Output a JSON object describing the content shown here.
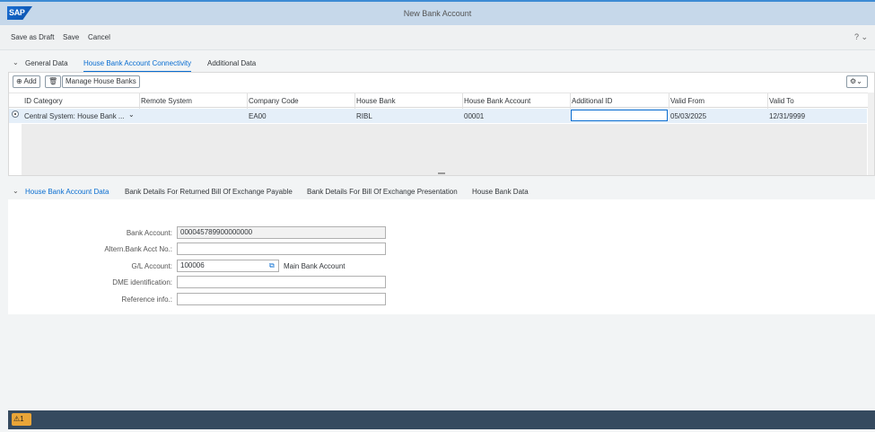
{
  "window": {
    "logo": "SAP",
    "title": "New Bank Account"
  },
  "toolbar": {
    "save_draft": "Save as Draft",
    "save": "Save",
    "cancel": "Cancel",
    "help_icon": "help-icon"
  },
  "top_tabs": [
    "General Data",
    "House Bank Account Connectivity",
    "Additional Data"
  ],
  "grid": {
    "add_label": "Add",
    "manage_label": "Manage House Banks",
    "columns": [
      "ID Category",
      "Remote System",
      "Company Code",
      "House Bank",
      "House Bank Account",
      "Additional ID",
      "Valid From",
      "Valid To"
    ],
    "rows": [
      [
        "Central System: House Bank ...",
        "",
        "EA00",
        "RIBL",
        "00001",
        "",
        "05/03/2025",
        "12/31/9999"
      ]
    ]
  },
  "bottom_tabs": [
    "House Bank Account Data",
    "Bank Details For Returned Bill Of Exchange Payable",
    "Bank Details For Bill Of Exchange Presentation",
    "House Bank Data"
  ],
  "form": {
    "bank_account_label": "Bank Account:",
    "bank_account_value": "000045789900000000",
    "altern_label": "Altern.Bank Acct No.:",
    "altern_value": "",
    "gl_label": "G/L Account:",
    "gl_value": "100006",
    "gl_desc": "Main Bank Account",
    "dme_label": "DME identification:",
    "dme_value": "",
    "ref_label": "Reference info.:",
    "ref_value": ""
  },
  "status": {
    "warning_count": "1"
  },
  "colors": {
    "accent": "#0a6ed1",
    "titlebar": "#c6d8ea",
    "statusbar": "#354a5f",
    "warning": "#e9a538"
  }
}
